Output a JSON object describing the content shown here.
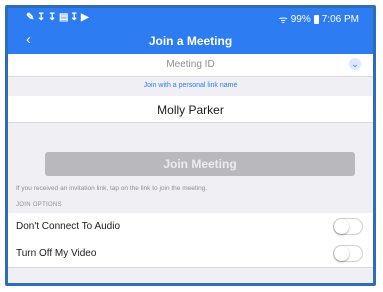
{
  "status_bar": {
    "icons": [
      "✎",
      "↧",
      "↧",
      "▤",
      "↧",
      "▶"
    ],
    "wifi": "ᯤ",
    "battery_text": "99%",
    "time": "7:06 PM"
  },
  "header": {
    "back": "‹",
    "title": "Join a Meeting"
  },
  "meeting_id": {
    "placeholder": "Meeting ID",
    "chevron": "⌄"
  },
  "pmi_link": "Join with a personal link name",
  "name_field": {
    "value": "Molly Parker"
  },
  "join_button": {
    "label": "Join Meeting"
  },
  "hint": "If you received an invitation link, tap on the link to join the meeting.",
  "options": {
    "section_label": "JOIN OPTIONS",
    "items": [
      {
        "label": "Don't Connect To Audio",
        "on": false
      },
      {
        "label": "Turn Off My Video",
        "on": false
      }
    ]
  },
  "colors": {
    "accent": "#2d7cf1",
    "frame": "#2f6db6",
    "disabled_button": "#b9b9bd"
  }
}
